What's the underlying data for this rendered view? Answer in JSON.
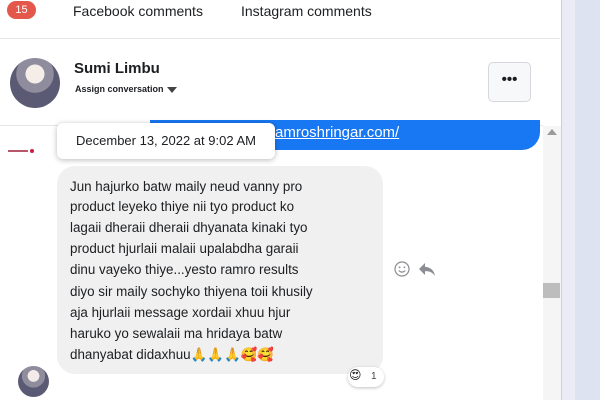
{
  "tabs": {
    "badge_count": "15",
    "facebook": "Facebook comments",
    "instagram": "Instagram comments"
  },
  "header": {
    "name": "Sumi Limbu",
    "assign": "Assign conversation",
    "more": "•••"
  },
  "previous_message": {
    "link_text": "amroshringar.com/"
  },
  "tooltip": {
    "timestamp": "December 13, 2022 at 9:02 AM"
  },
  "message": {
    "lines": [
      "Jun hajurko batw maily neud vanny  pro",
      "product leyeko thiye nii tyo product ko",
      "lagaii dheraii dheraii dhyanata kinaki tyo",
      "product hjurlaii malaii upalabdha garaii",
      "dinu vayeko thiye...yesto ramro results",
      "diyo sir maily sochyko thiyena toii khusily",
      "aja hjurlaii message xordaii xhuu hjur",
      "haruko yo sewalaii ma hridaya batw",
      "dhanyabat didaxhuu🙏🙏🙏🥰🥰"
    ]
  },
  "reaction": {
    "emoji": "😍",
    "count": "1"
  },
  "colors": {
    "brand_blue": "#1877f2",
    "badge_red": "#e4574b",
    "bubble_gray": "#f0f0f0"
  },
  "icons": [
    "caret-down-icon",
    "more-icon",
    "smiley-icon",
    "reply-icon",
    "scroll-up-icon"
  ]
}
